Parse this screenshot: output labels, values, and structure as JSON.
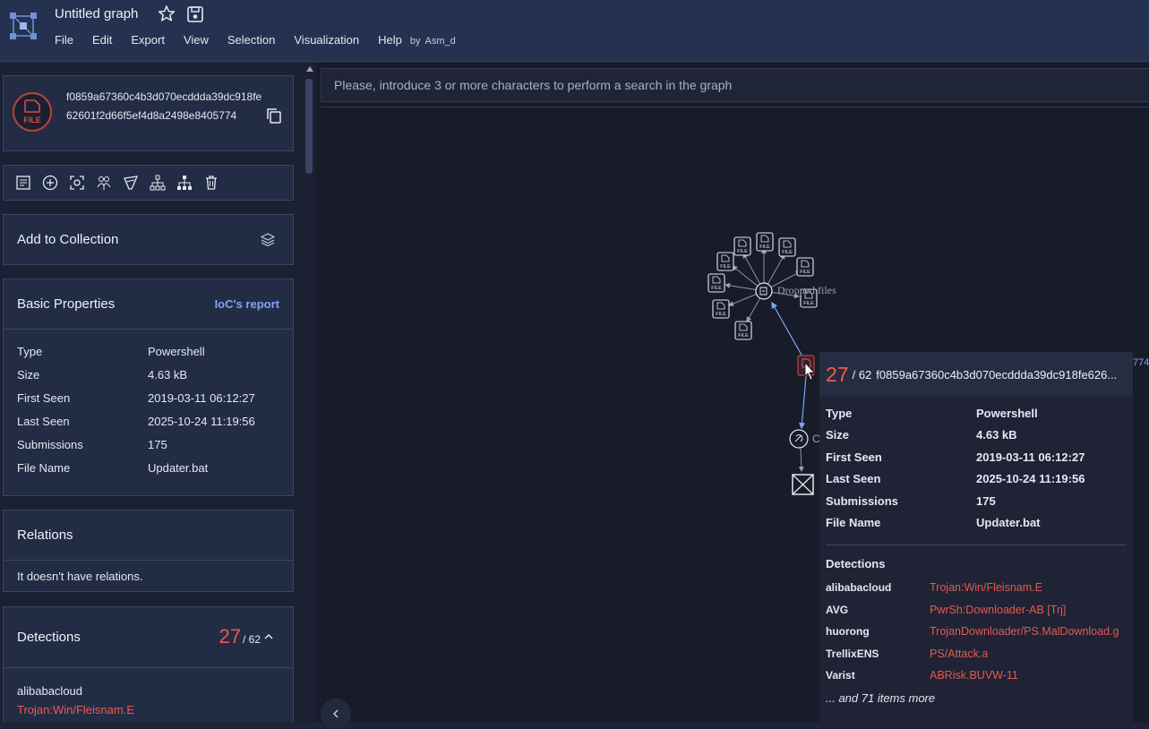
{
  "header": {
    "title": "Untitled graph",
    "menu": [
      "File",
      "Edit",
      "Export",
      "View",
      "Selection",
      "Visualization",
      "Help"
    ],
    "by_label": "by",
    "user": "Asm_d"
  },
  "sidebar": {
    "hash_card": {
      "icon_label": "FILE",
      "hash": "f0859a67360c4b3d070ecddda39dc918fe62601f2d66f5ef4d8a2498e8405774"
    },
    "collection": {
      "label": "Add to Collection"
    },
    "basic_properties": {
      "title": "Basic Properties",
      "ioc_link": "IoC's report",
      "rows": [
        {
          "label": "Type",
          "value": "Powershell"
        },
        {
          "label": "Size",
          "value": "4.63 kB"
        },
        {
          "label": "First Seen",
          "value": "2019-03-11 06:12:27"
        },
        {
          "label": "Last Seen",
          "value": "2025-10-24 11:19:56"
        },
        {
          "label": "Submissions",
          "value": "175"
        },
        {
          "label": "File Name",
          "value": "Updater.bat"
        }
      ]
    },
    "relations": {
      "title": "Relations",
      "empty_text": "It doesn't have relations."
    },
    "detections": {
      "title": "Detections",
      "positives": "27",
      "total": "/ 62",
      "first_engine": "alibabacloud",
      "first_result": "Trojan:Win/Fleisnam.E"
    }
  },
  "graph": {
    "search_placeholder": "Please, introduce 3 or more characters to perform a search in the graph",
    "node_label": "Dropped files",
    "c_label": "C",
    "edge_right_text": "774",
    "file_icon_label": "FILE"
  },
  "tooltip": {
    "positives": "27",
    "total": "/ 62",
    "hash": "f0859a67360c4b3d070ecddda39dc918fe626...",
    "rows": [
      {
        "label": "Type",
        "value": "Powershell"
      },
      {
        "label": "Size",
        "value": "4.63 kB"
      },
      {
        "label": "First Seen",
        "value": "2019-03-11 06:12:27"
      },
      {
        "label": "Last Seen",
        "value": "2025-10-24 11:19:56"
      },
      {
        "label": "Submissions",
        "value": "175"
      },
      {
        "label": "File Name",
        "value": "Updater.bat"
      }
    ],
    "detections_title": "Detections",
    "detections": [
      {
        "engine": "alibabacloud",
        "result": "Trojan:Win/Fleisnam.E"
      },
      {
        "engine": "AVG",
        "result": "PwrSh:Downloader-AB [Trj]"
      },
      {
        "engine": "huorong",
        "result": "TrojanDownloader/PS.MalDownload.g"
      },
      {
        "engine": "TrellixENS",
        "result": "PS/Attack.a"
      },
      {
        "engine": "Varist",
        "result": "ABRisk.BUVW-11"
      }
    ],
    "more_text": "... and 71 items more"
  },
  "colors": {
    "accent": "#7ba6f4",
    "danger": "#f05a4f",
    "header_bg": "#243150",
    "graph_bg": "#181b28"
  }
}
